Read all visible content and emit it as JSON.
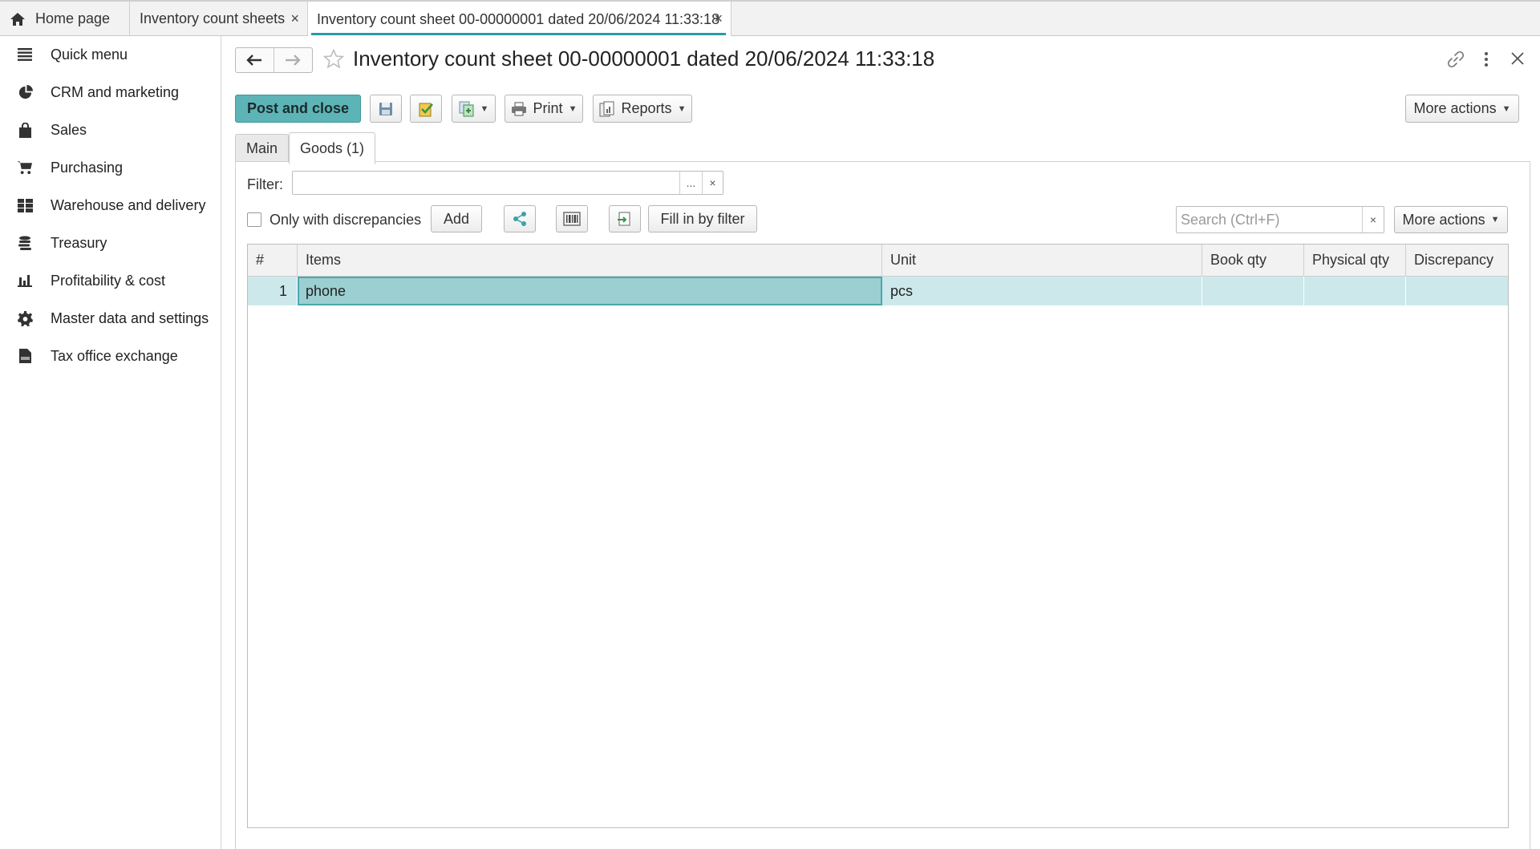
{
  "tabs": {
    "home": "Home page",
    "list": "Inventory count sheets",
    "active": "Inventory count sheet 00-00000001 dated 20/06/2024 11:33:18",
    "close_glyph": "×"
  },
  "sidebar": {
    "items": [
      {
        "label": "Quick menu",
        "icon": "menu-icon"
      },
      {
        "label": "CRM and marketing",
        "icon": "pie-chart-icon"
      },
      {
        "label": "Sales",
        "icon": "shopping-bag-icon"
      },
      {
        "label": "Purchasing",
        "icon": "cart-icon"
      },
      {
        "label": "Warehouse and delivery",
        "icon": "warehouse-icon"
      },
      {
        "label": "Treasury",
        "icon": "coins-icon"
      },
      {
        "label": "Profitability & cost",
        "icon": "bar-chart-icon"
      },
      {
        "label": "Master data and settings",
        "icon": "gear-icon"
      },
      {
        "label": "Tax office exchange",
        "icon": "tax-document-icon"
      }
    ]
  },
  "header": {
    "title": "Inventory count sheet 00-00000001 dated 20/06/2024 11:33:18"
  },
  "toolbar": {
    "post_and_close": "Post and close",
    "print": "Print",
    "reports": "Reports",
    "more_actions": "More actions"
  },
  "form_tabs": {
    "main": "Main",
    "goods": "Goods (1)"
  },
  "goods": {
    "filter_label": "Filter:",
    "filter_value": "",
    "filter_dots": "...",
    "clear_glyph": "×",
    "only_discrepancies_label": "Only with discrepancies",
    "only_discrepancies_checked": false,
    "add_label": "Add",
    "fill_in_by_filter": "Fill in by filter",
    "search_placeholder": "Search (Ctrl+F)",
    "more_actions": "More actions",
    "columns": [
      "#",
      "Items",
      "Unit",
      "Book qty",
      "Physical qty",
      "Discrepancy"
    ],
    "rows": [
      {
        "num": "1",
        "item": "phone",
        "unit": "pcs",
        "book_qty": "",
        "physical_qty": "",
        "discrepancy": ""
      }
    ]
  },
  "colors": {
    "accent": "#2a9aa2",
    "primary_button": "#5db4b6",
    "row_selected": "#cde8ea",
    "cell_selected": "#9ccfd2"
  }
}
